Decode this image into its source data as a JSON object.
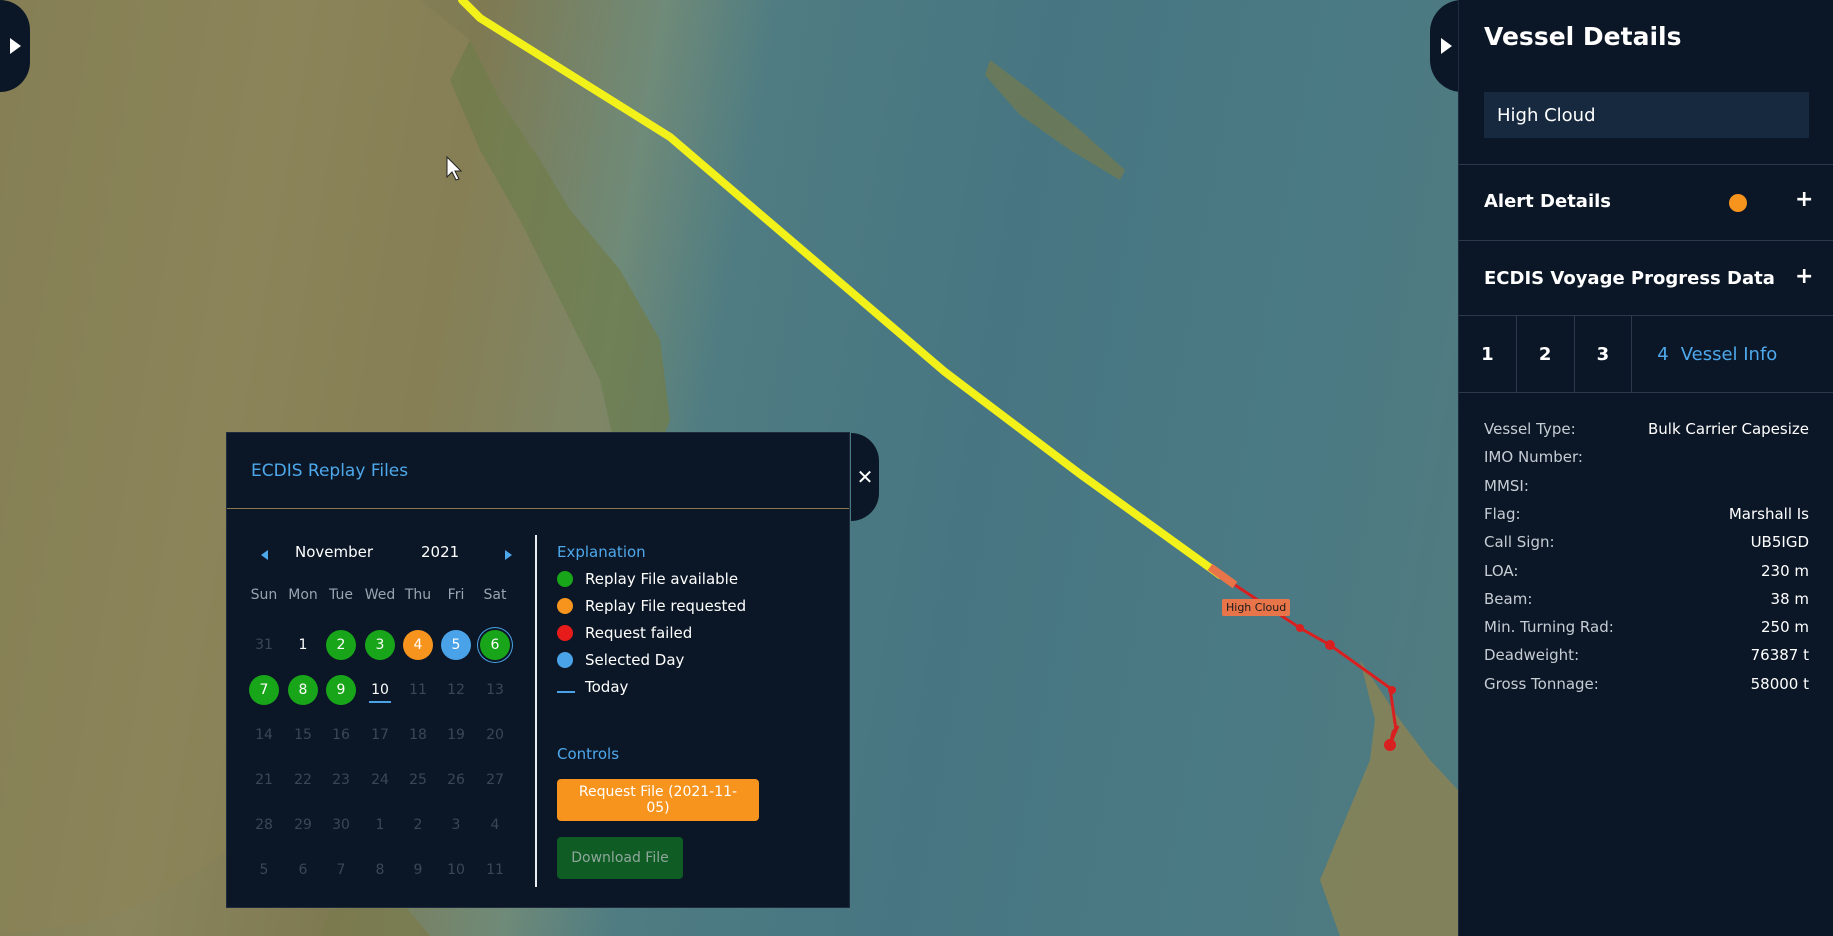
{
  "map": {
    "vessel_label": "High Cloud"
  },
  "replay": {
    "title": "ECDIS Replay Files",
    "month": "November",
    "year": "2021",
    "weekdays": [
      "Sun",
      "Mon",
      "Tue",
      "Wed",
      "Thu",
      "Fri",
      "Sat"
    ],
    "days": [
      [
        "31",
        "1",
        "2",
        "3",
        "4",
        "5",
        "6"
      ],
      [
        "7",
        "8",
        "9",
        "10",
        "11",
        "12",
        "13"
      ],
      [
        "14",
        "15",
        "16",
        "17",
        "18",
        "19",
        "20"
      ],
      [
        "21",
        "22",
        "23",
        "24",
        "25",
        "26",
        "27"
      ],
      [
        "28",
        "29",
        "30",
        "1",
        "2",
        "3",
        "4"
      ],
      [
        "5",
        "6",
        "7",
        "8",
        "9",
        "10",
        "11"
      ]
    ],
    "explanation_title": "Explanation",
    "legend": {
      "available": "Replay File available",
      "requested": "Replay File requested",
      "failed": "Request failed",
      "selected": "Selected Day",
      "today": "Today"
    },
    "controls_title": "Controls",
    "request_label": "Request File (2021-11-05)",
    "download_label": "Download File"
  },
  "colors": {
    "available": "#19a519",
    "requested": "#f7941d",
    "failed": "#e81b1b",
    "selected": "#4aa3e8",
    "track": "#f2f21a",
    "recent_track": "#d92020"
  },
  "panel": {
    "title": "Vessel Details",
    "vessel_name": "High Cloud",
    "alert_details": "Alert Details",
    "ecdis_progress": "ECDIS Voyage Progress Data",
    "tabs": [
      "1",
      "2",
      "3"
    ],
    "active_tab_num": "4",
    "active_tab_label": "Vessel Info",
    "info": [
      {
        "k": "Vessel Type:",
        "v": "Bulk Carrier Capesize"
      },
      {
        "k": "IMO Number:",
        "v": ""
      },
      {
        "k": "MMSI:",
        "v": ""
      },
      {
        "k": "Flag:",
        "v": "Marshall Is"
      },
      {
        "k": "Call Sign:",
        "v": "UB5IGD"
      },
      {
        "k": "LOA:",
        "v": "230 m"
      },
      {
        "k": "Beam:",
        "v": "38 m"
      },
      {
        "k": "Min. Turning Rad:",
        "v": "250 m"
      },
      {
        "k": "Deadweight:",
        "v": "76387 t"
      },
      {
        "k": "Gross Tonnage:",
        "v": "58000 t"
      }
    ]
  }
}
